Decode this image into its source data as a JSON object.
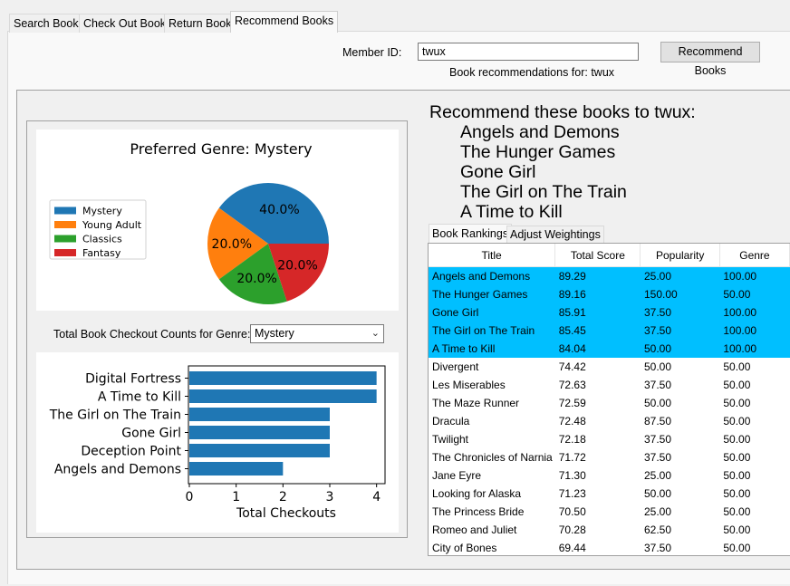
{
  "tabs": [
    {
      "label": "Search Books"
    },
    {
      "label": "Check Out Book"
    },
    {
      "label": "Return Book"
    },
    {
      "label": "Recommend Books"
    }
  ],
  "member": {
    "label": "Member ID:",
    "value": "twux",
    "button": "Recommend Books",
    "status": "Book recommendations for: twux"
  },
  "recommend": {
    "title": "Recommend these books to twux:",
    "items": [
      "Angels and Demons",
      "The Hunger Games",
      "Gone Girl",
      "The Girl on The Train",
      "A Time to Kill"
    ]
  },
  "genre_select": {
    "label": "Total Book Checkout Counts for Genre:",
    "value": "Mystery"
  },
  "subtabs": [
    {
      "label": "Book Rankings"
    },
    {
      "label": "Adjust Weightings"
    }
  ],
  "table": {
    "columns": [
      "Title",
      "Total Score",
      "Popularity",
      "Genre"
    ],
    "rows": [
      [
        "Angels and Demons",
        "89.29",
        "25.00",
        "100.00"
      ],
      [
        "The Hunger Games",
        "89.16",
        "150.00",
        "50.00"
      ],
      [
        "Gone Girl",
        "85.91",
        "37.50",
        "100.00"
      ],
      [
        "The Girl on The Train",
        "85.45",
        "37.50",
        "100.00"
      ],
      [
        "A Time to Kill",
        "84.04",
        "50.00",
        "100.00"
      ],
      [
        "Divergent",
        "74.42",
        "50.00",
        "50.00"
      ],
      [
        "Les Miserables",
        "72.63",
        "37.50",
        "50.00"
      ],
      [
        "The Maze Runner",
        "72.59",
        "50.00",
        "50.00"
      ],
      [
        "Dracula",
        "72.48",
        "87.50",
        "50.00"
      ],
      [
        "Twilight",
        "72.18",
        "37.50",
        "50.00"
      ],
      [
        "The Chronicles of Narnia",
        "71.72",
        "37.50",
        "50.00"
      ],
      [
        "Jane Eyre",
        "71.30",
        "25.00",
        "50.00"
      ],
      [
        "Looking for Alaska",
        "71.23",
        "50.00",
        "50.00"
      ],
      [
        "The Princess Bride",
        "70.50",
        "25.00",
        "50.00"
      ],
      [
        "Romeo and Juliet",
        "70.28",
        "62.50",
        "50.00"
      ],
      [
        "City of Bones",
        "69.44",
        "37.50",
        "50.00"
      ]
    ],
    "selected_count": 5,
    "highlight_color": "#00bfff"
  },
  "chart_data": [
    {
      "type": "pie",
      "title": "Preferred Genre: Mystery",
      "categories": [
        "Mystery",
        "Young Adult",
        "Classics",
        "Fantasy"
      ],
      "values": [
        40.0,
        20.0,
        20.0,
        20.0
      ],
      "labels": [
        "40.0%",
        "20.0%",
        "20.0%",
        "20.0%"
      ],
      "colors": [
        "#1f77b4",
        "#ff7f0e",
        "#2ca02c",
        "#d62728"
      ],
      "legend": "left"
    },
    {
      "type": "bar",
      "orientation": "horizontal",
      "categories": [
        "Digital Fortress",
        "A Time to Kill",
        "The Girl on The Train",
        "Gone Girl",
        "Deception Point",
        "Angels and Demons"
      ],
      "values": [
        4,
        4,
        3,
        3,
        3,
        2
      ],
      "xlabel": "Total Checkouts",
      "ylabel": "",
      "xlim": [
        0,
        4.2
      ],
      "xticks": [
        0,
        1,
        2,
        3,
        4
      ],
      "color": "#1f77b4"
    }
  ]
}
